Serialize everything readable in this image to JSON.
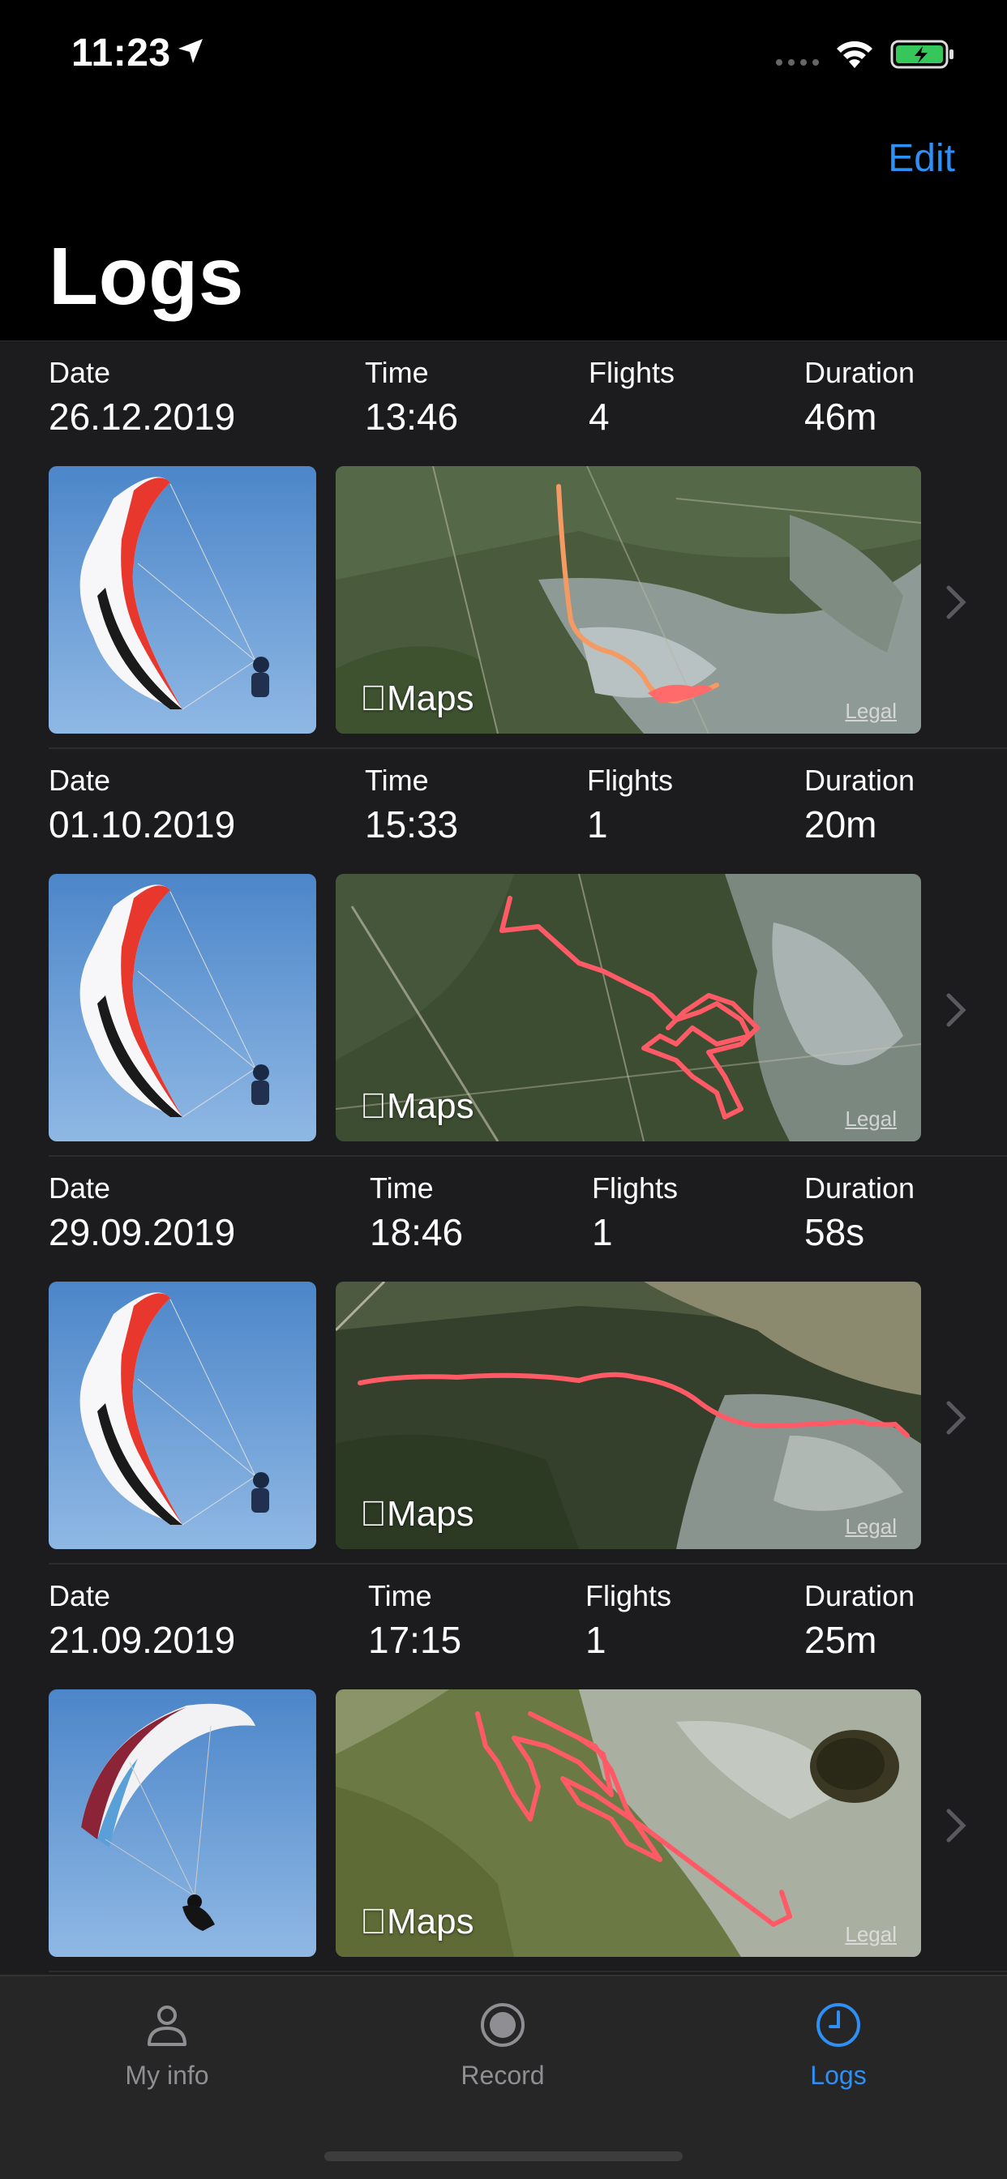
{
  "status": {
    "time": "11:23"
  },
  "nav": {
    "edit_label": "Edit",
    "title": "Logs"
  },
  "labels": {
    "date": "Date",
    "time": "Time",
    "flights": "Flights",
    "duration": "Duration",
    "maps": "Maps",
    "legal": "Legal"
  },
  "logs": [
    {
      "date": "26.12.2019",
      "time": "13:46",
      "flights": "4",
      "duration": "46m"
    },
    {
      "date": "01.10.2019",
      "time": "15:33",
      "flights": "1",
      "duration": "20m"
    },
    {
      "date": "29.09.2019",
      "time": "18:46",
      "flights": "1",
      "duration": "58s"
    },
    {
      "date": "21.09.2019",
      "time": "17:15",
      "flights": "1",
      "duration": "25m"
    }
  ],
  "tabs": [
    {
      "label": "My info",
      "icon": "person-icon"
    },
    {
      "label": "Record",
      "icon": "record-icon"
    },
    {
      "label": "Logs",
      "icon": "clock-icon",
      "active": true
    }
  ],
  "colors": {
    "accent": "#2e8ff4",
    "track_orange": "#f59a63",
    "track_red": "#ff5a66"
  }
}
